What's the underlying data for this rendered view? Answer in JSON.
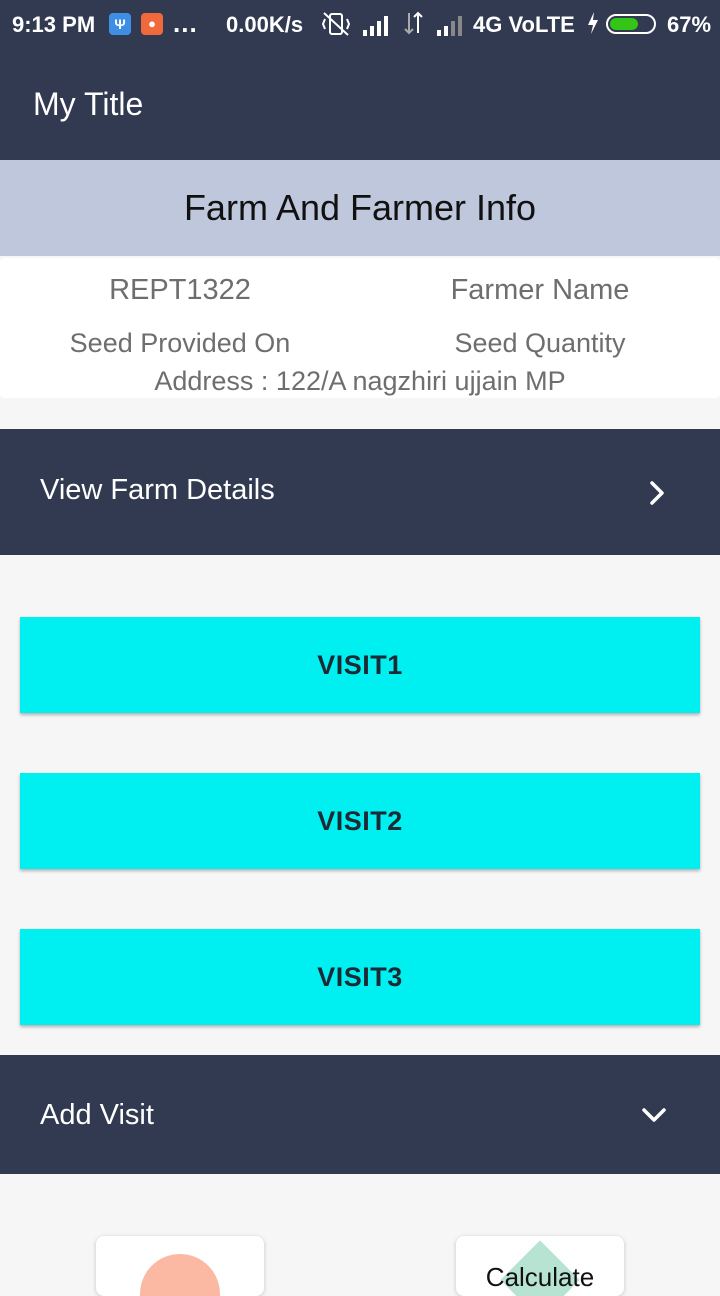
{
  "status_bar": {
    "time": "9:13 PM",
    "notif_dots": "...",
    "net_speed": "0.00K/s",
    "network": "4G VoLTE",
    "battery_percent": "67%",
    "battery_level": 0.67
  },
  "app_bar": {
    "title": "My Title"
  },
  "section": {
    "title": "Farm And Farmer Info"
  },
  "info": {
    "id": "REPT1322",
    "farmer_name": "Farmer Name",
    "seed_provided_on": "Seed Provided On",
    "seed_quantity": "Seed Quantity",
    "address": "Address : 122/A nagzhiri ujjain MP"
  },
  "farm_details": {
    "label": "View Farm Details"
  },
  "visits": [
    "VISIT1",
    "VISIT2",
    "VISIT3"
  ],
  "add_visit": {
    "label": "Add Visit"
  },
  "bottom_tiles": {
    "calculate_label": "Calculate"
  },
  "colors": {
    "primary": "#313a51",
    "section_header": "#bfc7dc",
    "visit_button": "#00eff0",
    "battery": "#34c517"
  }
}
